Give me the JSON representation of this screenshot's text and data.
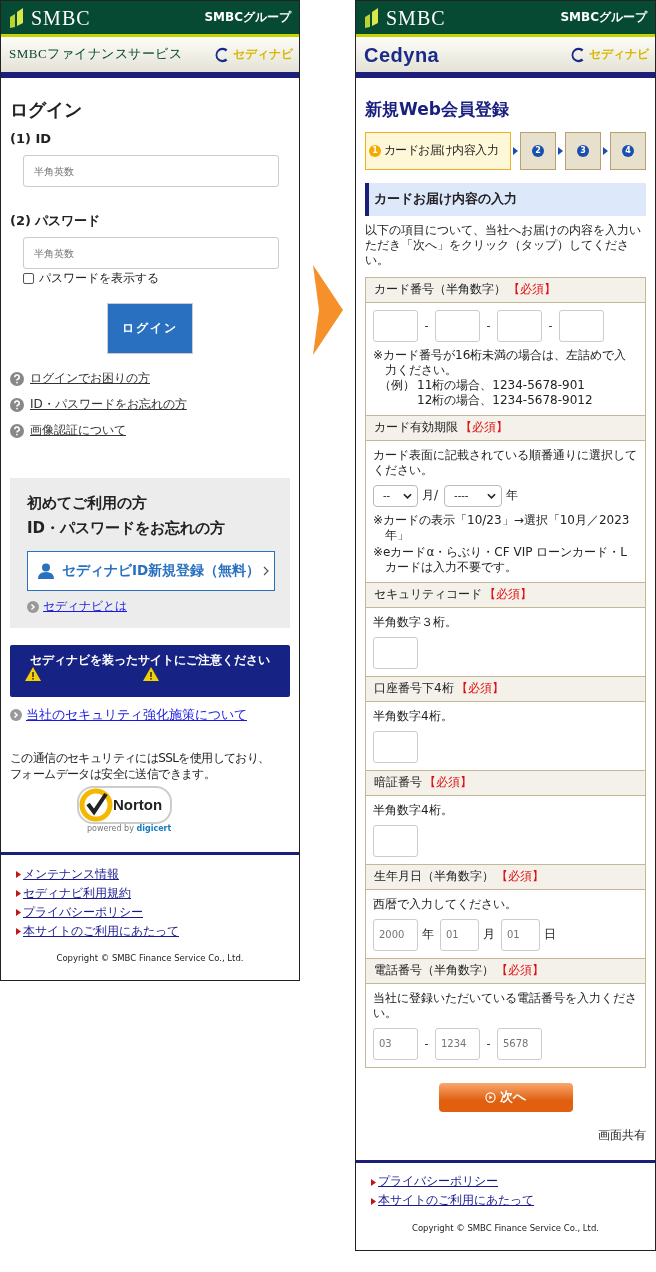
{
  "login_page": {
    "header": {
      "brand": "SMBC",
      "group": "SMBCグループ",
      "company": "SMBCファイナンスサービス",
      "navi_logo": "セディナビ"
    },
    "title": "ログイン",
    "fields": [
      {
        "label": "(1) ID",
        "placeholder": "半角英数"
      },
      {
        "label": "(2) パスワード",
        "placeholder": "半角英数"
      }
    ],
    "show_password": {
      "label": "パスワードを表示する",
      "checked": false
    },
    "login_button": "ログイン",
    "help_links": [
      "ログインでお困りの方",
      "ID・パスワードをお忘れの方",
      "画像認証について"
    ],
    "new_user_panel": {
      "heading_lines": [
        "初めてご利用の方",
        "ID・パスワードをお忘れの方"
      ],
      "register_button": "セディナビID新規登録（無料）",
      "about_link": "セディナビとは"
    },
    "warning_banner": "セディナビを装ったサイトにご注意ください",
    "security_link": "当社のセキュリティ強化施策について",
    "ssl_note_lines": [
      "この通信のセキュリティにはSSLを使用しており、",
      "フォームデータは安全に送信できます。"
    ],
    "norton_badge": {
      "name": "Norton",
      "powered_by": "powered by",
      "vendor": "digicert"
    },
    "footer_links": [
      "メンテナンス情報",
      "セディナビ利用規約",
      "プライバシーポリシー",
      "本サイトのご利用にあたって"
    ],
    "copyright": "Copyright © SMBC Finance Service Co., Ltd."
  },
  "registration_page": {
    "header": {
      "brand": "SMBC",
      "group": "SMBCグループ",
      "company": "Cedyna",
      "navi_logo": "セディナビ"
    },
    "title": "新規Web会員登録",
    "steps": [
      {
        "number": "1",
        "label": "カードお届け内容入力",
        "selected": true
      },
      {
        "number": "2",
        "selected": false
      },
      {
        "number": "3",
        "selected": false
      },
      {
        "number": "4",
        "selected": false
      }
    ],
    "section_title": "カードお届け内容の入力",
    "intro": "以下の項目について、当社へお届けの内容を入力いただき「次へ」をクリック（タップ）してください。",
    "form_sections": [
      {
        "kind": "card_number",
        "label": "カード番号（半角数字）",
        "required": "【必須】",
        "separator": "-",
        "notes": [
          "※カード番号が16桁未満の場合は、左詰めで入力ください。"
        ],
        "example": {
          "label": "（例）",
          "lines": [
            "11桁の場合、1234-5678-901",
            "12桁の場合、1234-5678-9012"
          ]
        }
      },
      {
        "kind": "expiry",
        "label": "カード有効期限",
        "required": "【必須】",
        "hint": "カード表面に記載されている順番通りに選択してください。",
        "selects": [
          {
            "value": "--",
            "unit": "月/"
          },
          {
            "value": "----",
            "unit": "年"
          }
        ],
        "notes": [
          "※カードの表示「10/23」→選択「10月／2023年」",
          "※eカードα・らぶり・CF VIP ローンカード・Lカードは入力不要です。"
        ]
      },
      {
        "kind": "single",
        "label": "セキュリティコード",
        "required": "【必須】",
        "hint": "半角数字３桁。"
      },
      {
        "kind": "single",
        "label": "口座番号下4桁",
        "required": "【必須】",
        "hint": "半角数字4桁。"
      },
      {
        "kind": "single",
        "label": "暗証番号",
        "required": "【必須】",
        "hint": "半角数字4桁。"
      },
      {
        "kind": "date",
        "label": "生年月日（半角数字）",
        "required": "【必須】",
        "hint": "西暦で入力してください。",
        "inputs": [
          {
            "placeholder": "2000",
            "unit": "年"
          },
          {
            "placeholder": "01",
            "unit": "月"
          },
          {
            "placeholder": "01",
            "unit": "日"
          }
        ]
      },
      {
        "kind": "phone",
        "label": "電話番号（半角数字）",
        "required": "【必須】",
        "hint": "当社に登録いただいている電話番号を入力ください。",
        "separator": "-",
        "inputs": [
          {
            "placeholder": "03"
          },
          {
            "placeholder": "1234"
          },
          {
            "placeholder": "5678"
          }
        ]
      }
    ],
    "next_button": "次へ",
    "screen_share": "画面共有",
    "footer_links": [
      "プライバシーポリシー",
      "本サイトのご利用にあたって"
    ],
    "copyright": "Copyright © SMBC Finance Service Co., Ltd."
  }
}
